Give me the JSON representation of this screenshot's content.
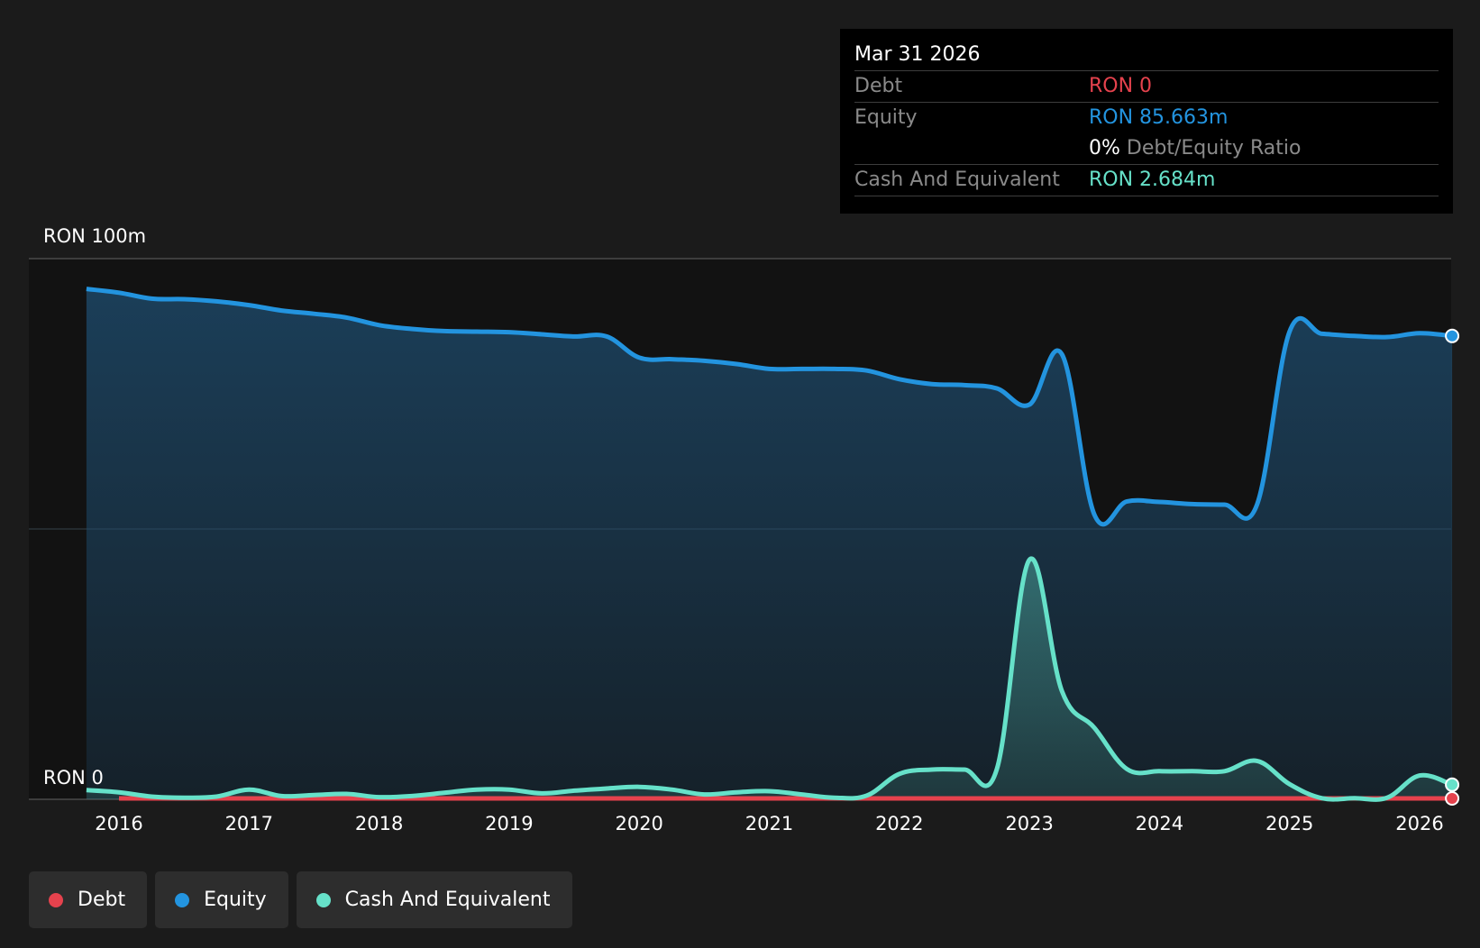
{
  "tooltip": {
    "date": "Mar 31 2026",
    "debt_label": "Debt",
    "debt_value": "RON 0",
    "equity_label": "Equity",
    "equity_value": "RON 85.663m",
    "ratio_value": "0%",
    "ratio_label": "Debt/Equity Ratio",
    "cash_label": "Cash And Equivalent",
    "cash_value": "RON 2.684m"
  },
  "colors": {
    "debt": "#e5424d",
    "equity": "#2394df",
    "cash": "#66e1c9",
    "background": "#1b1b1b"
  },
  "legend": [
    {
      "label": "Debt",
      "color": "#e5424d"
    },
    {
      "label": "Equity",
      "color": "#2394df"
    },
    {
      "label": "Cash And Equivalent",
      "color": "#66e1c9"
    }
  ],
  "chart_data": {
    "type": "area",
    "y_top_label": "RON 100m",
    "y_bottom_label": "RON 0",
    "ylim": [
      0,
      100
    ],
    "xlim": [
      2015.55,
      2026.25
    ],
    "x_ticks": [
      "2016",
      "2017",
      "2018",
      "2019",
      "2020",
      "2021",
      "2022",
      "2023",
      "2024",
      "2025",
      "2026"
    ],
    "series": [
      {
        "name": "Debt",
        "color": "#e5424d",
        "x": [
          2015.75,
          2026.25
        ],
        "y": [
          0,
          0
        ]
      },
      {
        "name": "Equity",
        "color": "#2394df",
        "x": [
          2015.75,
          2016.0,
          2016.25,
          2016.5,
          2016.75,
          2017.0,
          2017.25,
          2017.5,
          2017.75,
          2018.0,
          2018.25,
          2018.5,
          2018.75,
          2019.0,
          2019.25,
          2019.5,
          2019.75,
          2020.0,
          2020.25,
          2020.5,
          2020.75,
          2021.0,
          2021.25,
          2021.5,
          2021.75,
          2022.0,
          2022.25,
          2022.5,
          2022.75,
          2023.0,
          2023.25,
          2023.5,
          2023.75,
          2024.0,
          2024.25,
          2024.5,
          2024.75,
          2025.0,
          2025.25,
          2025.5,
          2025.75,
          2026.0,
          2026.25
        ],
        "y": [
          94.4,
          93.7,
          92.6,
          92.5,
          92.1,
          91.4,
          90.4,
          89.8,
          89.1,
          87.7,
          87.0,
          86.6,
          86.5,
          86.4,
          86.0,
          85.6,
          85.6,
          81.7,
          81.4,
          81.1,
          80.5,
          79.6,
          79.6,
          79.6,
          79.3,
          77.7,
          76.8,
          76.6,
          76.0,
          73.0,
          82.3,
          52.6,
          55.1,
          55.0,
          54.6,
          54.5,
          54.5,
          86.5,
          86.1,
          85.7,
          85.5,
          86.2,
          85.7
        ]
      },
      {
        "name": "Cash And Equivalent",
        "color": "#66e1c9",
        "x": [
          2015.75,
          2016.0,
          2016.25,
          2016.5,
          2016.75,
          2017.0,
          2017.25,
          2017.5,
          2017.75,
          2018.0,
          2018.25,
          2018.5,
          2018.75,
          2019.0,
          2019.25,
          2019.5,
          2019.75,
          2020.0,
          2020.25,
          2020.5,
          2020.75,
          2021.0,
          2021.25,
          2021.5,
          2021.75,
          2022.0,
          2022.25,
          2022.5,
          2022.75,
          2023.0,
          2023.25,
          2023.5,
          2023.75,
          2024.0,
          2024.25,
          2024.5,
          2024.75,
          2025.0,
          2025.25,
          2025.5,
          2025.75,
          2026.0,
          2026.25
        ],
        "y": [
          1.7,
          1.3,
          0.5,
          0.3,
          0.5,
          1.8,
          0.6,
          0.8,
          1.0,
          0.4,
          0.6,
          1.2,
          1.8,
          1.8,
          1.1,
          1.6,
          2.0,
          2.3,
          1.8,
          0.9,
          1.3,
          1.5,
          0.9,
          0.3,
          0.7,
          4.7,
          5.5,
          5.5,
          5.6,
          44.3,
          20.0,
          13.2,
          5.6,
          5.2,
          5.2,
          5.2,
          7.1,
          2.8,
          0.2,
          0.2,
          0.3,
          4.4,
          2.7
        ]
      }
    ]
  }
}
